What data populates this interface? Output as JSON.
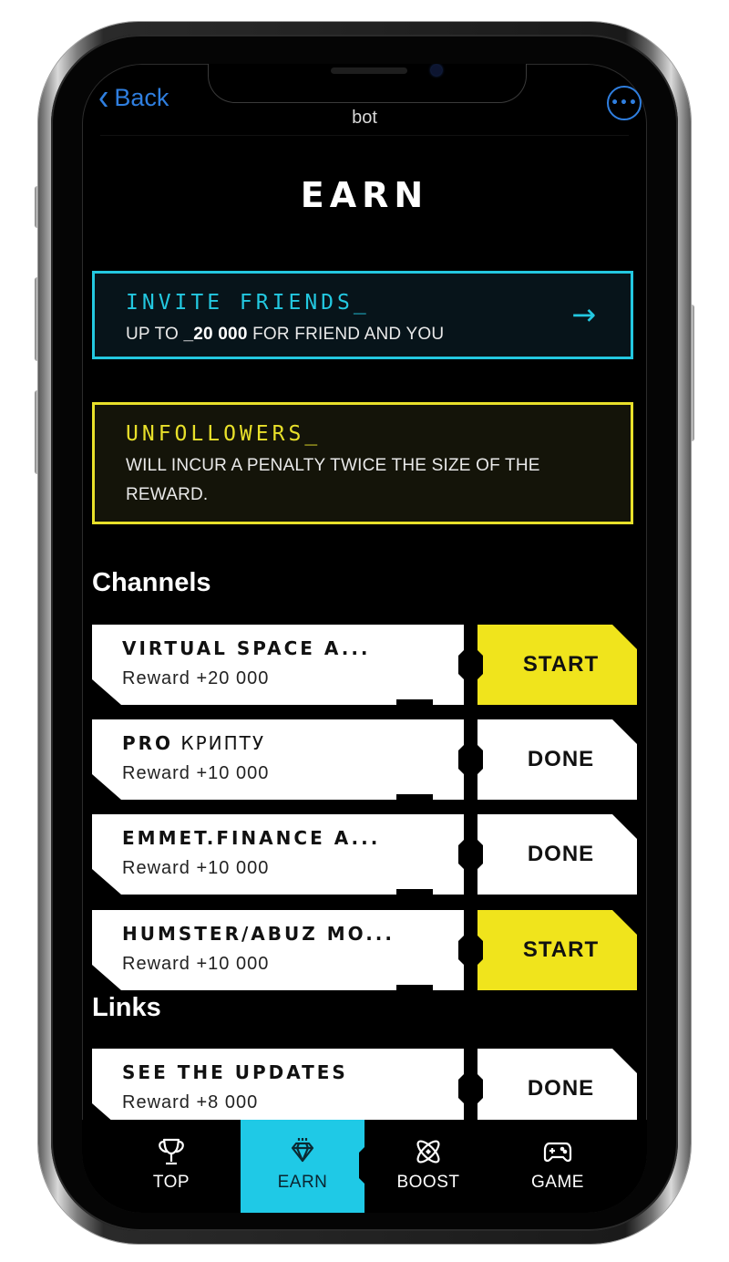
{
  "header": {
    "back_label": "Back",
    "title": "bot",
    "more_icon": "more-horizontal-icon"
  },
  "page": {
    "title": "EARN"
  },
  "banners": {
    "invite": {
      "title": "INVITE FRIENDS_",
      "text_prefix": "UP TO ",
      "text_amount": "_20 000",
      "text_suffix": " FOR FRIEND AND YOU",
      "icon": "arrow-right-icon",
      "accent": "#23c8e0"
    },
    "unfollowers": {
      "title": "UNFOLLOWERS_",
      "text": "WILL INCUR A PENALTY TWICE THE SIZE OF THE REWARD.",
      "accent": "#e8e02a"
    }
  },
  "sections": {
    "channels": {
      "title": "Channels",
      "items": [
        {
          "name_bold": "VIRTUAL SPACE A...",
          "name_light": "",
          "reward": "Reward +20 000",
          "action": "START",
          "state": "start"
        },
        {
          "name_bold": "PRO",
          "name_light": " КРИПТУ",
          "reward": "Reward +10 000",
          "action": "DONE",
          "state": "done"
        },
        {
          "name_bold": "EMMET.FINANCE A...",
          "name_light": "",
          "reward": "Reward +10 000",
          "action": "DONE",
          "state": "done"
        },
        {
          "name_bold": "HUMSTER/ABUZ MO...",
          "name_light": "",
          "reward": "Reward +10 000",
          "action": "START",
          "state": "start"
        }
      ]
    },
    "links": {
      "title": "Links",
      "items": [
        {
          "name_bold": "SEE THE UPDATES",
          "name_light": "",
          "reward": "Reward +8 000",
          "action": "DONE",
          "state": "done"
        }
      ]
    }
  },
  "nav": {
    "items": [
      {
        "label": "TOP",
        "icon": "trophy-icon",
        "active": false
      },
      {
        "label": "EARN",
        "icon": "diamond-icon",
        "active": true
      },
      {
        "label": "BOOST",
        "icon": "atom-icon",
        "active": false
      },
      {
        "label": "GAME",
        "icon": "gamepad-icon",
        "active": false
      }
    ],
    "active_color": "#1fc9e6"
  },
  "colors": {
    "start_button": "#f0e41c",
    "done_button": "#ffffff",
    "link_blue": "#2f7fe0"
  }
}
